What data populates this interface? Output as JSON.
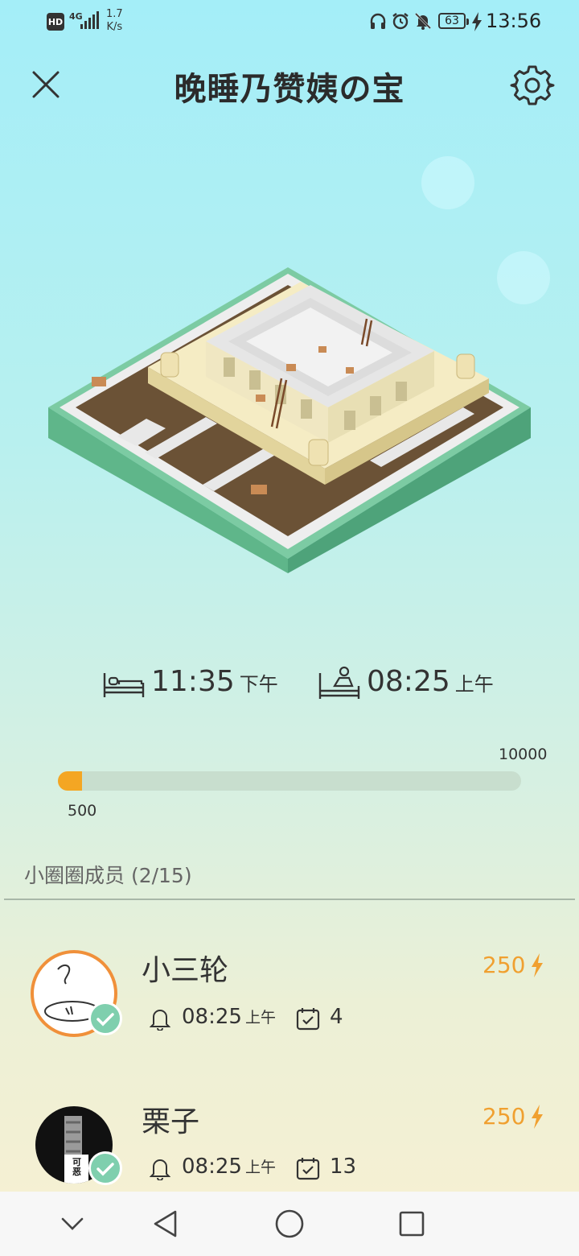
{
  "status_bar": {
    "network_badge": "HD",
    "signal_type": "4G",
    "speed_value": "1.7",
    "speed_unit": "K/s",
    "battery": "63",
    "time": "13:56"
  },
  "header": {
    "title": "晚睡乃赞姨の宝",
    "close_icon": "close-icon",
    "settings_icon": "gear-icon"
  },
  "sleep": {
    "bedtime": "11:35",
    "bedtime_period": "下午",
    "wake_time": "08:25",
    "wake_period": "上午"
  },
  "progress": {
    "current": 500,
    "max": 10000,
    "current_label": "500",
    "max_label": "10000",
    "fill_fraction": 0.052,
    "color": "#f4a623"
  },
  "members": {
    "section_title": "小圈圈成员 (2/15)",
    "list": [
      {
        "name": "小三轮",
        "energy": "250",
        "alarm_time": "08:25",
        "alarm_period": "上午",
        "days": "4"
      },
      {
        "name": "栗子",
        "energy": "250",
        "alarm_time": "08:25",
        "alarm_period": "上午",
        "days": "13"
      }
    ]
  },
  "avatar_text": "可恶",
  "colors": {
    "accent": "#f0a030",
    "badge": "#7fcfae",
    "avatar_ring": "#f0903a"
  }
}
